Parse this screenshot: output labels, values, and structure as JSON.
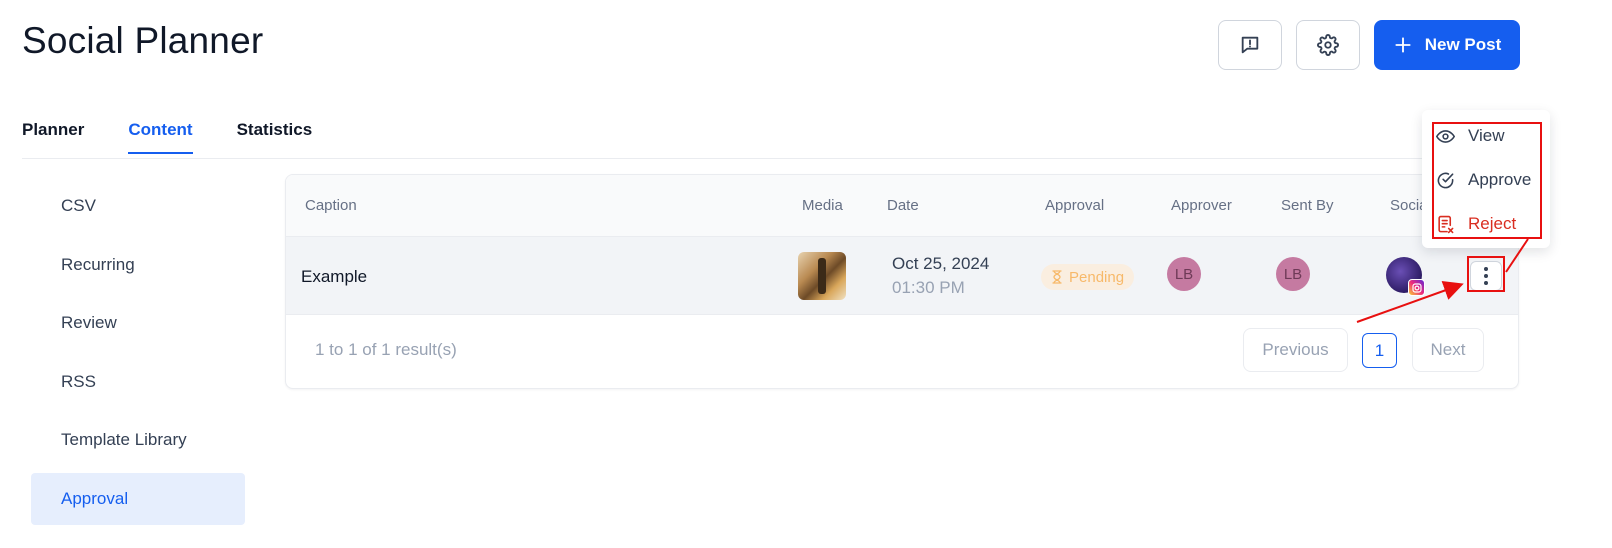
{
  "header": {
    "title": "Social Planner",
    "new_post_label": "New Post",
    "feedback_icon": "message-alert-icon",
    "settings_icon": "gear-icon"
  },
  "tabs": [
    {
      "label": "Planner",
      "active": false
    },
    {
      "label": "Content",
      "active": true
    },
    {
      "label": "Statistics",
      "active": false
    }
  ],
  "sidebar": {
    "items": [
      {
        "label": "CSV"
      },
      {
        "label": "Recurring"
      },
      {
        "label": "Review"
      },
      {
        "label": "RSS"
      },
      {
        "label": "Template Library"
      },
      {
        "label": "Approval",
        "active": true
      }
    ]
  },
  "table": {
    "columns": [
      "Caption",
      "Media",
      "Date",
      "Approval",
      "Approver",
      "Sent By",
      "Social"
    ],
    "rows": [
      {
        "caption": "Example",
        "date": "Oct 25, 2024",
        "time": "01:30 PM",
        "approval": "Pending",
        "approver_initials": "LB",
        "sent_by_initials": "LB",
        "social_network": "instagram-icon"
      }
    ],
    "results_text": "1 to 1 of 1 result(s)",
    "pagination": {
      "previous_label": "Previous",
      "current_page": "1",
      "next_label": "Next"
    }
  },
  "row_menu": {
    "items": [
      {
        "label": "View",
        "icon": "eye-icon"
      },
      {
        "label": "Approve",
        "icon": "check-circle-icon"
      },
      {
        "label": "Reject",
        "icon": "reject-document-icon"
      }
    ]
  },
  "colors": {
    "accent": "#155eef",
    "pending_text": "#f7b96a",
    "pending_bg": "#faeee0",
    "reject": "#d92d20",
    "annotation": "#e81010"
  }
}
